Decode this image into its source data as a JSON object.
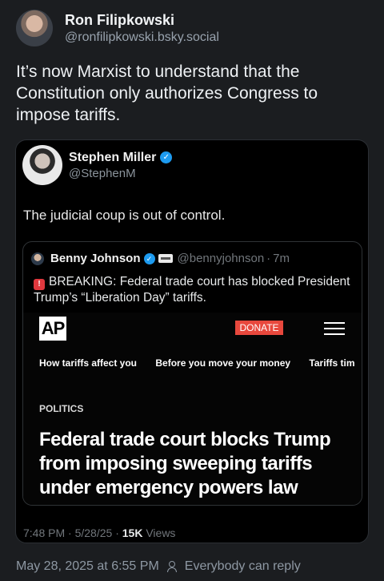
{
  "author": {
    "name": "Ron Filipkowski",
    "handle": "@ronfilipkowski.bsky.social"
  },
  "post_text": "It’s now Marxist to understand that the Constitution only authorizes Congress to impose tariffs.",
  "embed": {
    "name": "Stephen Miller",
    "handle": "@StephenM",
    "text": "The judicial coup is out of control.",
    "quote": {
      "name": "Benny Johnson",
      "handle": "@bennyjohnson",
      "time": "7m",
      "text": "BREAKING: Federal trade court has blocked President Trump’s “Liberation Day” tariffs.",
      "article": {
        "logo": "AP",
        "donate_label": "DONATE",
        "topics": [
          "How tariffs affect you",
          "Before you move your money",
          "Tariffs timelin"
        ],
        "section": "POLITICS",
        "headline": "Federal trade court blocks Trump from imposing sweeping tariffs under emergency powers law"
      }
    },
    "meta": {
      "time": "7:48 PM",
      "date": "5/28/25",
      "views_count": "15K",
      "views_label": "Views"
    }
  },
  "footer": {
    "timestamp": "May 28, 2025 at 6:55 PM",
    "reply_setting": "Everybody can reply"
  },
  "colors": {
    "background": "#1b1d20",
    "verified": "#1d9bf0",
    "donate": "#e8483d"
  }
}
